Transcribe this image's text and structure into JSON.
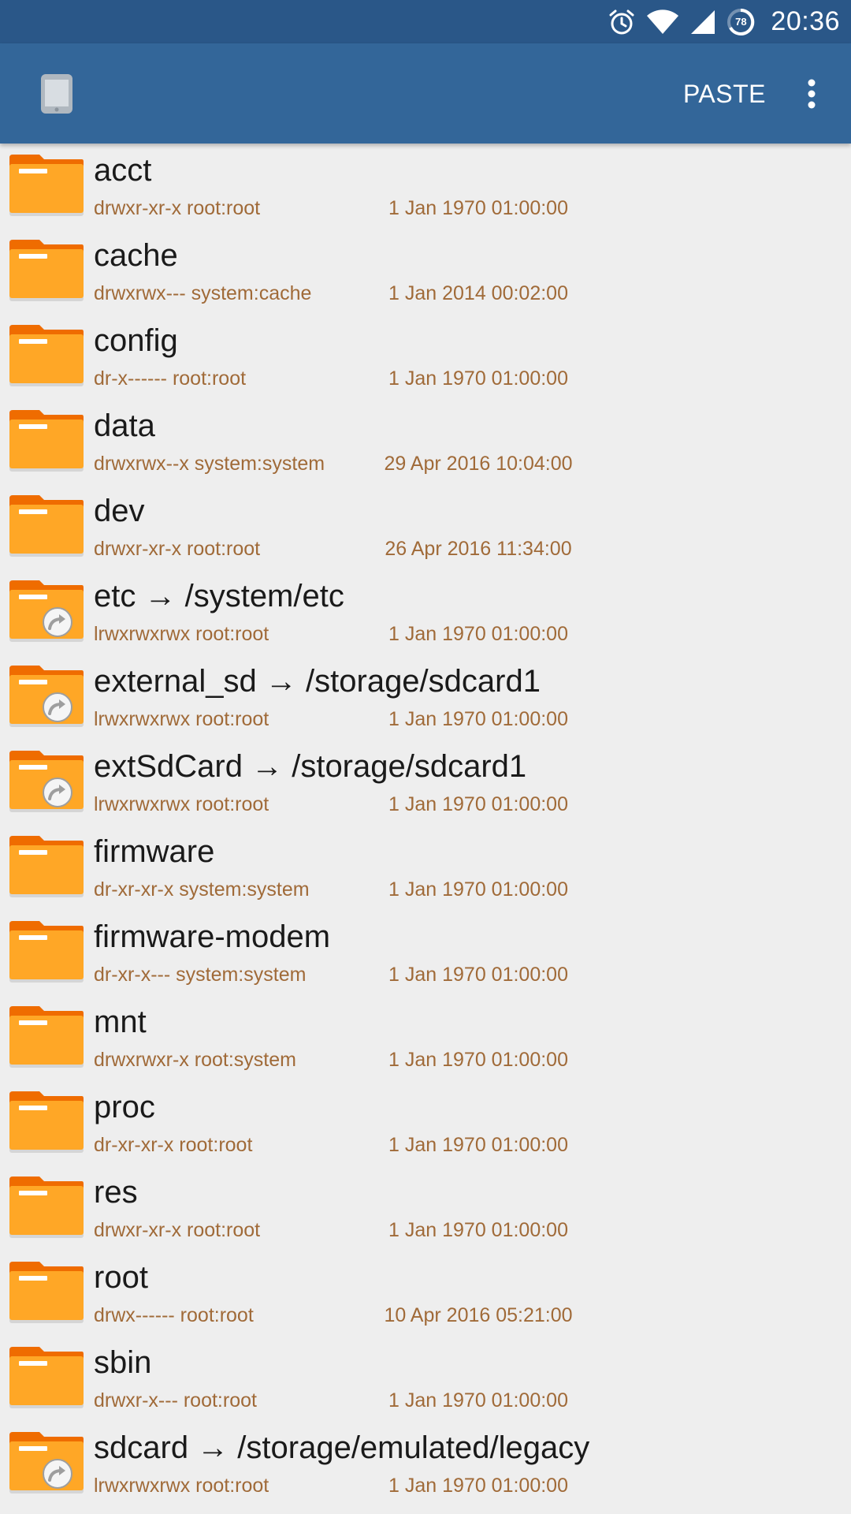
{
  "status_bar": {
    "time": "20:36",
    "battery_level": "78",
    "icons": [
      "alarm-icon",
      "wifi-icon",
      "signal-icon",
      "battery-icon"
    ]
  },
  "toolbar": {
    "device_icon": "phone-icon",
    "paste_label": "PASTE",
    "overflow_icon": "more-vert-icon"
  },
  "colors": {
    "status_bar": "#2a5788",
    "toolbar": "#336699",
    "folder": "#ffa726",
    "folder_tab": "#ef6c00",
    "meta_text": "#a06a38"
  },
  "files": [
    {
      "name": "acct",
      "perms": "drwxr-xr-x root:root",
      "date": "1 Jan 1970 01:00:00",
      "link": false
    },
    {
      "name": "cache",
      "perms": "drwxrwx--- system:cache",
      "date": "1 Jan 2014 00:02:00",
      "link": false
    },
    {
      "name": "config",
      "perms": "dr-x------ root:root",
      "date": "1 Jan 1970 01:00:00",
      "link": false
    },
    {
      "name": "data",
      "perms": "drwxrwx--x system:system",
      "date": "29 Apr 2016 10:04:00",
      "link": false
    },
    {
      "name": "dev",
      "perms": "drwxr-xr-x root:root",
      "date": "26 Apr 2016 11:34:00",
      "link": false
    },
    {
      "name": "etc → /system/etc",
      "perms": "lrwxrwxrwx root:root",
      "date": "1 Jan 1970 01:00:00",
      "link": true
    },
    {
      "name": "external_sd → /storage/sdcard1",
      "perms": "lrwxrwxrwx root:root",
      "date": "1 Jan 1970 01:00:00",
      "link": true
    },
    {
      "name": "extSdCard → /storage/sdcard1",
      "perms": "lrwxrwxrwx root:root",
      "date": "1 Jan 1970 01:00:00",
      "link": true
    },
    {
      "name": "firmware",
      "perms": "dr-xr-xr-x system:system",
      "date": "1 Jan 1970 01:00:00",
      "link": false
    },
    {
      "name": "firmware-modem",
      "perms": "dr-xr-x--- system:system",
      "date": "1 Jan 1970 01:00:00",
      "link": false
    },
    {
      "name": "mnt",
      "perms": "drwxrwxr-x root:system",
      "date": "1 Jan 1970 01:00:00",
      "link": false
    },
    {
      "name": "proc",
      "perms": "dr-xr-xr-x root:root",
      "date": "1 Jan 1970 01:00:00",
      "link": false
    },
    {
      "name": "res",
      "perms": "drwxr-xr-x root:root",
      "date": "1 Jan 1970 01:00:00",
      "link": false
    },
    {
      "name": "root",
      "perms": "drwx------ root:root",
      "date": "10 Apr 2016 05:21:00",
      "link": false
    },
    {
      "name": "sbin",
      "perms": "drwxr-x--- root:root",
      "date": "1 Jan 1970 01:00:00",
      "link": false
    },
    {
      "name": "sdcard → /storage/emulated/legacy",
      "perms": "lrwxrwxrwx root:root",
      "date": "1 Jan 1970 01:00:00",
      "link": true
    }
  ]
}
